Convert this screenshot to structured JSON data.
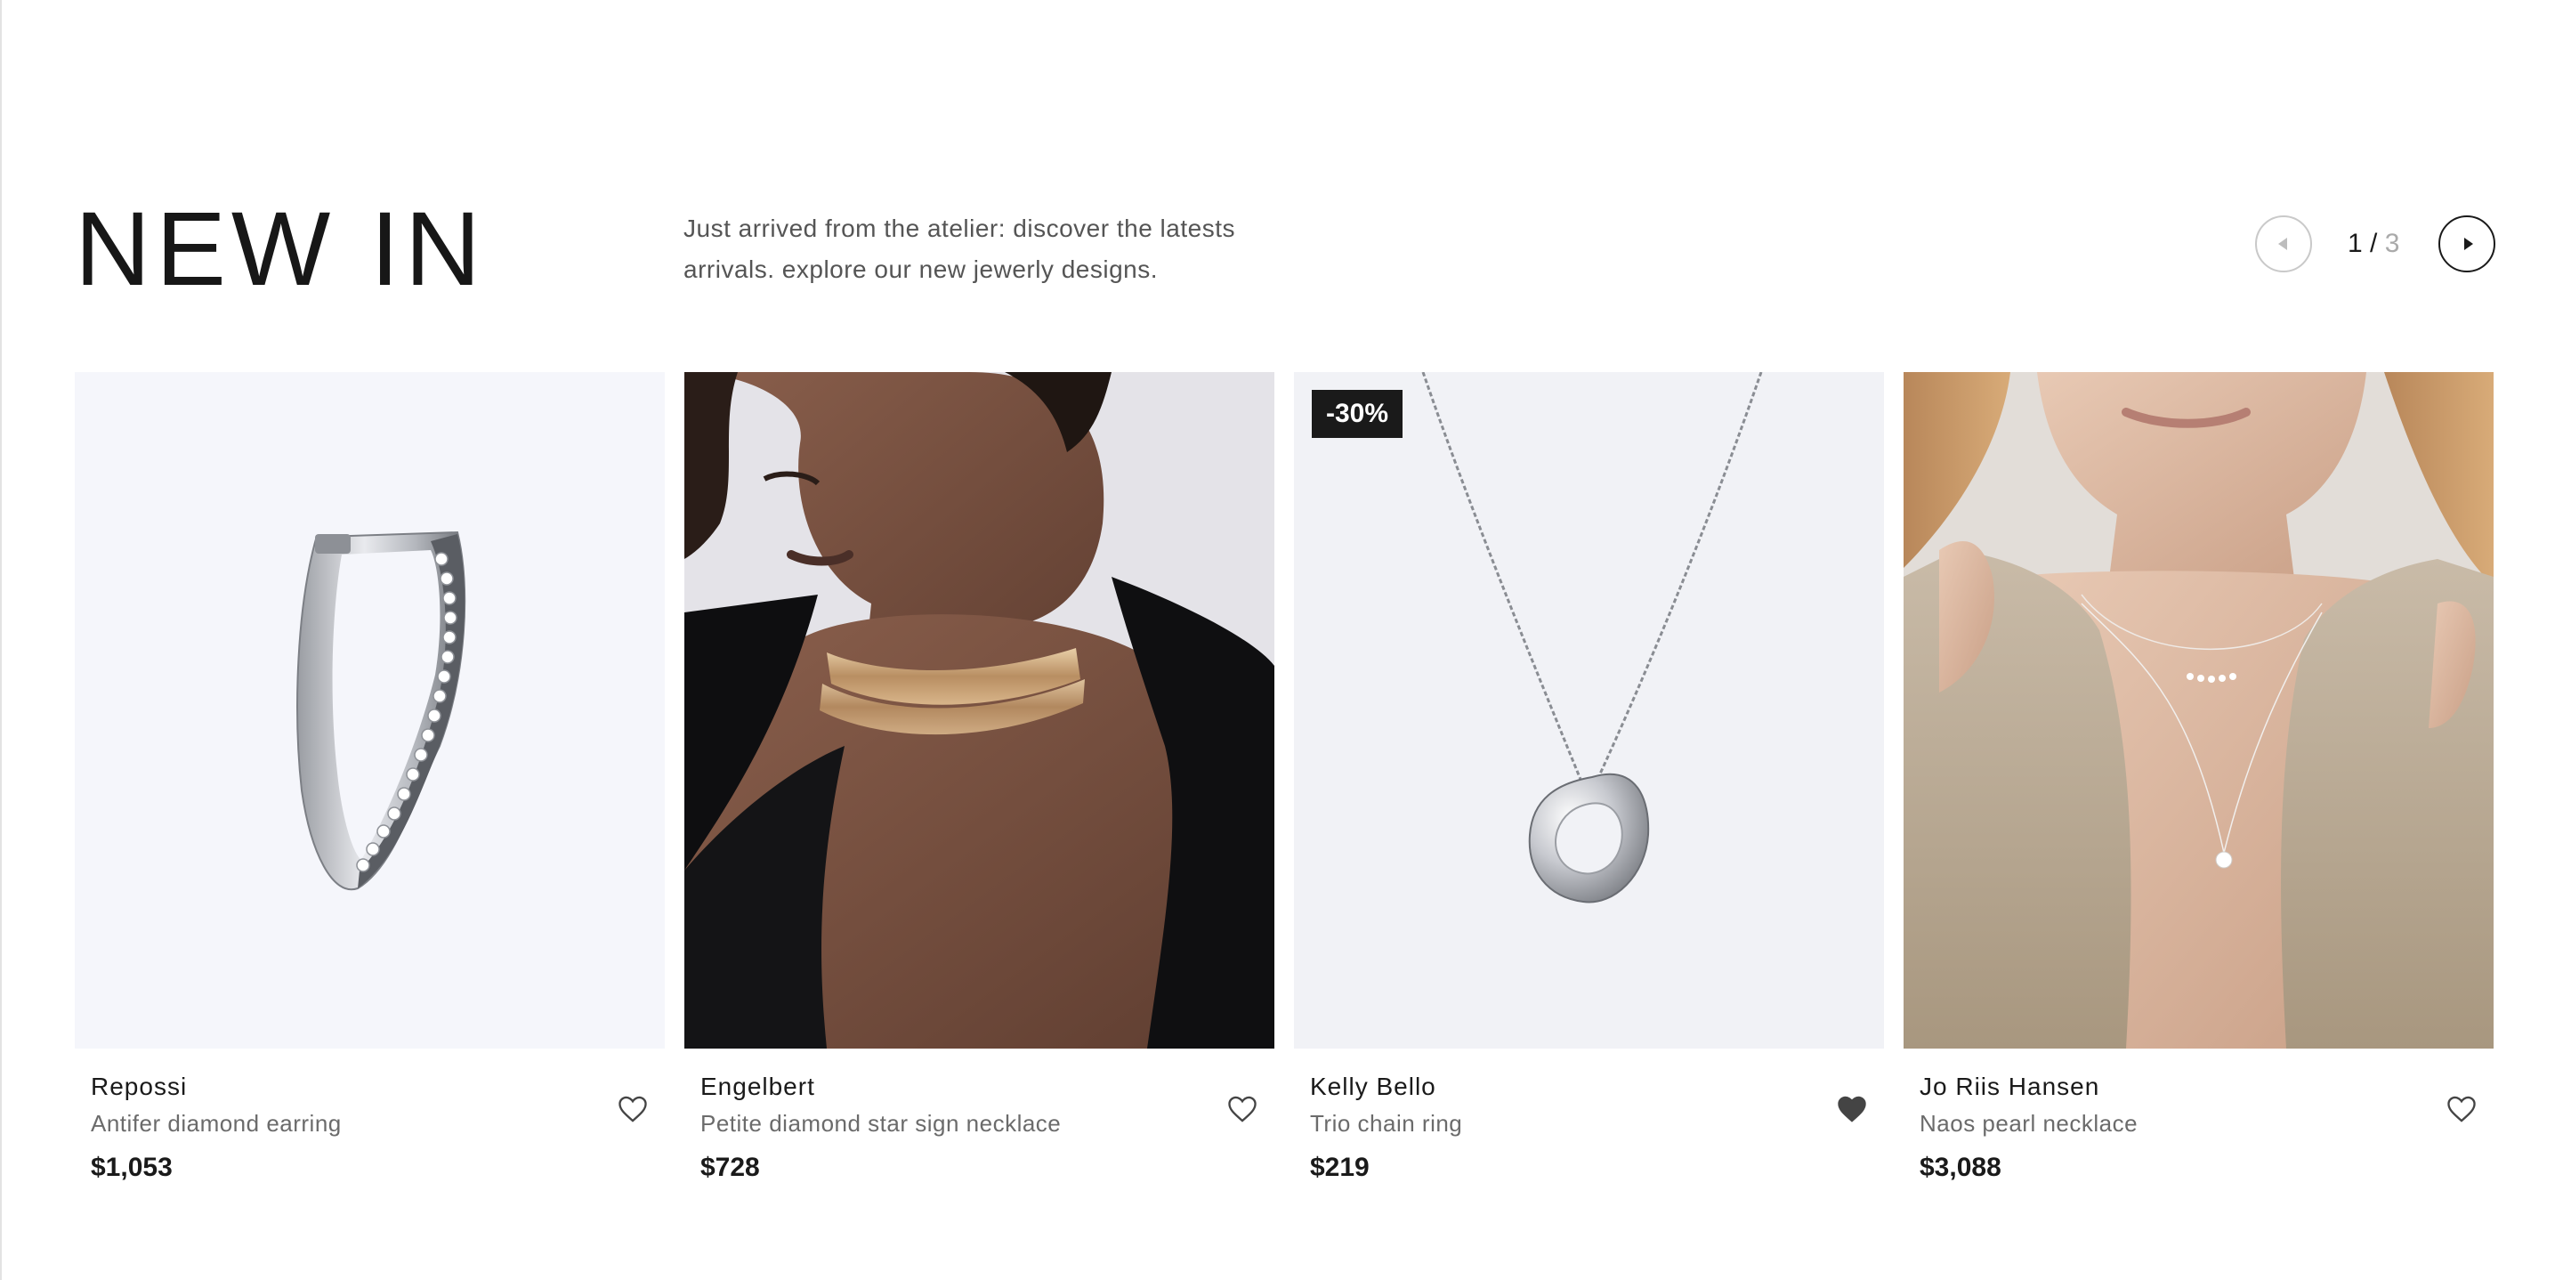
{
  "section": {
    "title": "NEW IN",
    "subtitle": "Just arrived from the atelier: discover the latests arrivals. explore our new jewerly designs."
  },
  "pager": {
    "current": "1",
    "separator": "/",
    "total": "3",
    "prev_icon": "chevron-left-icon",
    "next_icon": "chevron-right-icon"
  },
  "products": [
    {
      "brand": "Repossi",
      "name": "Antifer diamond earring",
      "price": "$1,053",
      "badge": "",
      "favorited": false
    },
    {
      "brand": "Engelbert",
      "name": "Petite diamond star sign necklace",
      "price": "$728",
      "badge": "",
      "favorited": false
    },
    {
      "brand": "Kelly Bello",
      "name": "Trio chain ring",
      "price": "$219",
      "badge": "-30%",
      "favorited": true
    },
    {
      "brand": "Jo Riis Hansen",
      "name": "Naos pearl necklace",
      "price": "$3,088",
      "badge": "",
      "favorited": false
    }
  ],
  "colors": {
    "text": "#1a1a1a",
    "muted": "#6b6b6b",
    "badge_bg": "#1a1a1a",
    "card_bg_product": "#f5f6fa"
  }
}
